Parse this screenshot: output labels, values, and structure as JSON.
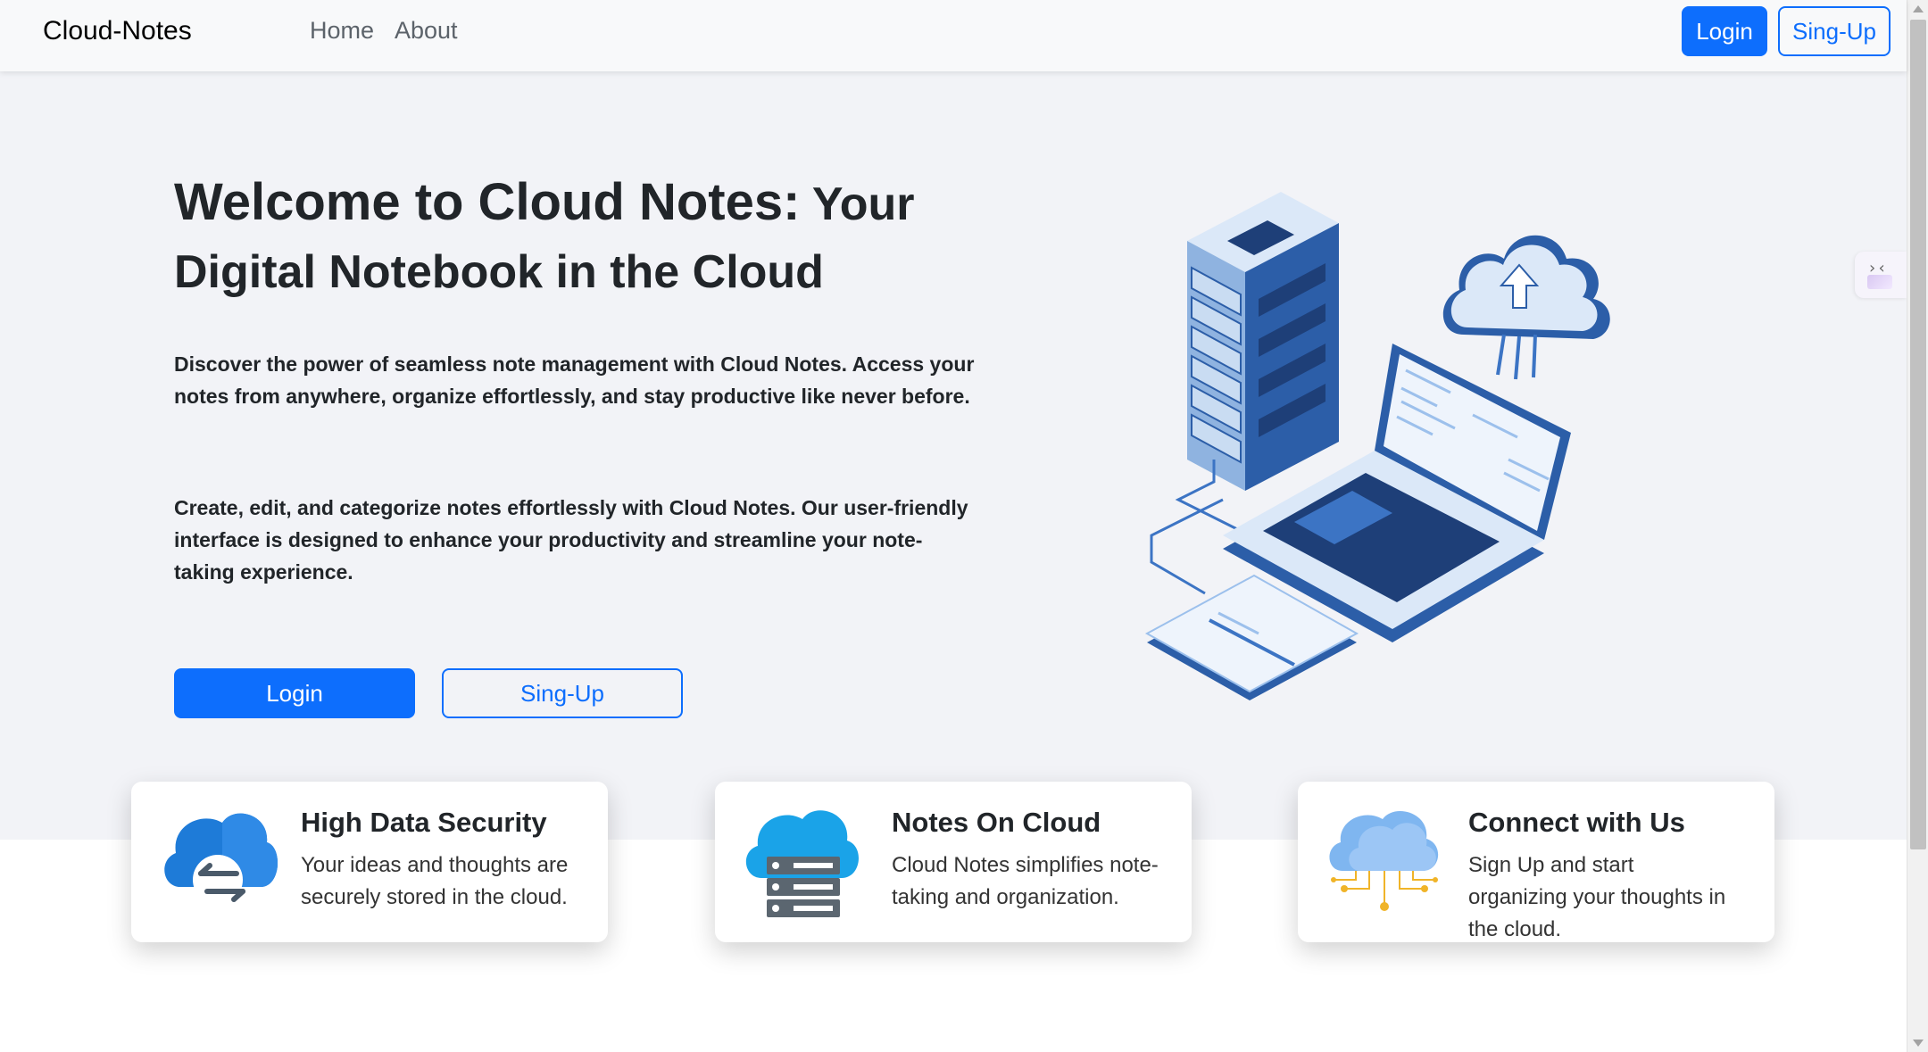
{
  "navbar": {
    "brand": "Cloud-Notes",
    "links": [
      "Home",
      "About"
    ],
    "login_label": "Login",
    "signup_label": "Sing-Up"
  },
  "hero": {
    "title_lead": "Welcome to Cloud Notes:",
    "title_rest": " Your Digital Notebook in the Cloud",
    "paragraph_1": "Discover the power of seamless note management with Cloud Notes. Access your notes from anywhere, organize effortlessly, and stay productive like never before.",
    "paragraph_2": "Create, edit, and categorize notes effortlessly with Cloud Notes. Our user-friendly interface is designed to enhance your productivity and streamline your note-taking experience.",
    "login_label": "Login",
    "signup_label": "Sing-Up",
    "illustration_icon": "server-laptop-cloud-illustration"
  },
  "features": [
    {
      "icon": "cloud-transfer-icon",
      "title": "High Data Security",
      "text": "Your ideas and thoughts are securely stored in the cloud."
    },
    {
      "icon": "cloud-server-icon",
      "title": "Notes On Cloud",
      "text": "Cloud Notes simplifies note-taking and organization."
    },
    {
      "icon": "cloud-network-icon",
      "title": "Connect with Us",
      "text": "Sign Up and start organizing your thoughts in the cloud."
    }
  ],
  "side_widget": {
    "glyph": "›‹"
  },
  "colors": {
    "primary": "#0d6efd",
    "navbar_bg": "#f8f9fa",
    "hero_bg": "#f2f3f7"
  }
}
